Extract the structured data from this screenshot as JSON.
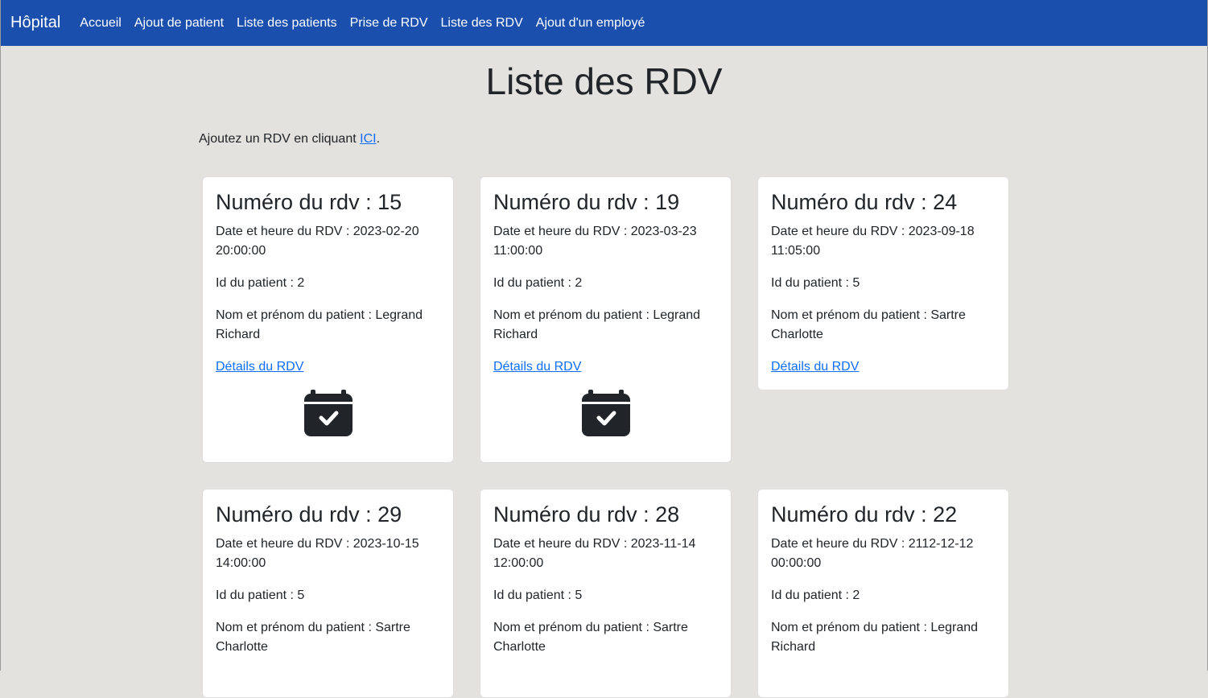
{
  "nav": {
    "brand": "Hôpital",
    "items": [
      "Accueil",
      "Ajout de patient",
      "Liste des patients",
      "Prise de RDV",
      "Liste des RDV",
      "Ajout d'un employé"
    ]
  },
  "page": {
    "title": "Liste des RDV",
    "intro_text": "Ajoutez un RDV en cliquant ",
    "intro_link": "ICI",
    "intro_end": "."
  },
  "cards": [
    {
      "title": "Numéro du rdv : 15",
      "date": "Date et heure du RDV : 2023-02-20 20:00:00",
      "patient_id": "Id du patient : 2",
      "patient_name": "Nom et prénom du patient : Legrand Richard",
      "details": "Détails du RDV",
      "icon": "calendar-check-icon"
    },
    {
      "title": "Numéro du rdv : 19",
      "date": "Date et heure du RDV : 2023-03-23 11:00:00",
      "patient_id": "Id du patient : 2",
      "patient_name": "Nom et prénom du patient : Legrand Richard",
      "details": "Détails du RDV",
      "icon": "calendar-check-icon"
    },
    {
      "title": "Numéro du rdv : 24",
      "date": "Date et heure du RDV : 2023-09-18 11:05:00",
      "patient_id": "Id du patient : 5",
      "patient_name": "Nom et prénom du patient : Sartre Charlotte",
      "details": "Détails du RDV"
    },
    {
      "title": "Numéro du rdv : 29",
      "date": "Date et heure du RDV : 2023-10-15 14:00:00",
      "patient_id": "Id du patient : 5",
      "patient_name": "Nom et prénom du patient : Sartre Charlotte"
    },
    {
      "title": "Numéro du rdv : 28",
      "date": "Date et heure du RDV : 2023-11-14 12:00:00",
      "patient_id": "Id du patient : 5",
      "patient_name": "Nom et prénom du patient : Sartre Charlotte"
    },
    {
      "title": "Numéro du rdv : 22",
      "date": "Date et heure du RDV : 2112-12-12 00:00:00",
      "patient_id": "Id du patient : 2",
      "patient_name": "Nom et prénom du patient : Legrand Richard"
    }
  ],
  "colors": {
    "navbar": "#1a4fae",
    "background": "#e4e2df",
    "link": "#0d6efd",
    "icon": "#212529"
  }
}
